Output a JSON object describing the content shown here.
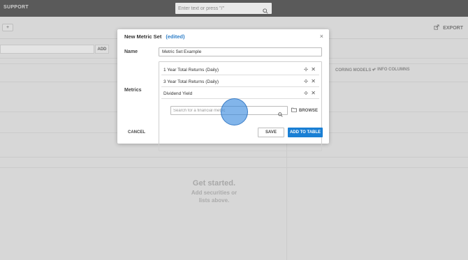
{
  "app": {
    "brand": "SUPPORT"
  },
  "search": {
    "placeholder": "Enter text or press \"/\""
  },
  "toolbar": {
    "add_label": "+",
    "export_label": "EXPORT"
  },
  "background": {
    "add_button": "ADD",
    "tabs": [
      "CORING MODELS ▾",
      "+ INFO COLUMNS"
    ],
    "empty_state": {
      "title": "Get started.",
      "line1": "Add securities or",
      "line2": "lists above."
    }
  },
  "dialog": {
    "title": "New Metric Set",
    "edited": "(edited)",
    "close": "×",
    "name_label": "Name",
    "name_value": "Metric Set Example",
    "metrics_label": "Metrics",
    "metrics": [
      {
        "label": "1 Year Total Returns (Daily)"
      },
      {
        "label": "3 Year Total Returns (Daily)"
      },
      {
        "label": "Dividend Yield"
      }
    ],
    "search_placeholder": "Search for a financial metric",
    "browse_label": "BROWSE",
    "cancel_label": "CANCEL",
    "save_label": "SAVE",
    "add_to_table_label": "ADD TO TABLE"
  },
  "colors": {
    "accent": "#1a7fd4",
    "edited": "#2f7fc8",
    "topbar": "#5a5a5a",
    "click_highlight": "#3688dd"
  },
  "icons": [
    "search-icon",
    "export-icon",
    "close-icon",
    "drag-handle-icon",
    "remove-icon",
    "folder-icon"
  ]
}
